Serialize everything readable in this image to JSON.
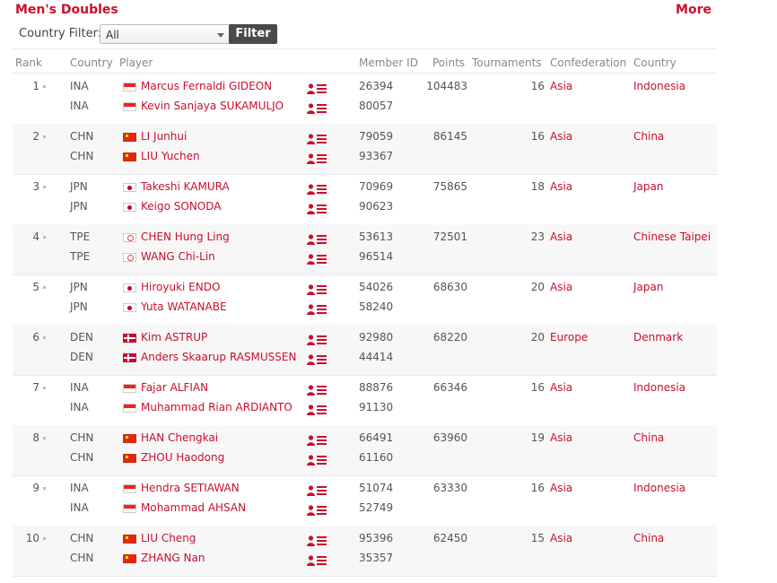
{
  "header": {
    "title": "Men's Doubles",
    "more": "More"
  },
  "filter": {
    "label": "Country Filter:",
    "selected": "All",
    "button": "Filter"
  },
  "columns": {
    "rank": "Rank",
    "country": "Country",
    "player": "Player",
    "member_id": "Member ID",
    "points": "Points",
    "tournaments": "Tournaments",
    "confederation": "Confederation",
    "country_name": "Country"
  },
  "colors": {
    "accent": "#c8102e",
    "button_bg": "#4a4a4a"
  },
  "icons": {
    "player_profile": "player-profile-icon",
    "rank_marker": "rank-dot-icon"
  },
  "rankings": [
    {
      "rank": "1",
      "points": "104483",
      "tournaments": "16",
      "confederation": "Asia",
      "country_name": "Indonesia",
      "players": [
        {
          "country": "INA",
          "flag": "flag-ina",
          "name": "Marcus Fernaldi GIDEON",
          "member_id": "26394"
        },
        {
          "country": "INA",
          "flag": "flag-ina",
          "name": "Kevin Sanjaya SUKAMULJO",
          "member_id": "80057"
        }
      ]
    },
    {
      "rank": "2",
      "points": "86145",
      "tournaments": "16",
      "confederation": "Asia",
      "country_name": "China",
      "players": [
        {
          "country": "CHN",
          "flag": "flag-chn",
          "name": "LI Junhui",
          "member_id": "79059"
        },
        {
          "country": "CHN",
          "flag": "flag-chn",
          "name": "LIU Yuchen",
          "member_id": "93367"
        }
      ]
    },
    {
      "rank": "3",
      "points": "75865",
      "tournaments": "18",
      "confederation": "Asia",
      "country_name": "Japan",
      "players": [
        {
          "country": "JPN",
          "flag": "flag-jpn",
          "name": "Takeshi KAMURA",
          "member_id": "70969"
        },
        {
          "country": "JPN",
          "flag": "flag-jpn",
          "name": "Keigo SONODA",
          "member_id": "90623"
        }
      ]
    },
    {
      "rank": "4",
      "points": "72501",
      "tournaments": "23",
      "confederation": "Asia",
      "country_name": "Chinese Taipei",
      "players": [
        {
          "country": "TPE",
          "flag": "flag-tpe",
          "name": "CHEN Hung Ling",
          "member_id": "53613"
        },
        {
          "country": "TPE",
          "flag": "flag-tpe",
          "name": "WANG Chi-Lin",
          "member_id": "96514"
        }
      ]
    },
    {
      "rank": "5",
      "points": "68630",
      "tournaments": "20",
      "confederation": "Asia",
      "country_name": "Japan",
      "players": [
        {
          "country": "JPN",
          "flag": "flag-jpn",
          "name": "Hiroyuki ENDO",
          "member_id": "54026"
        },
        {
          "country": "JPN",
          "flag": "flag-jpn",
          "name": "Yuta WATANABE",
          "member_id": "58240"
        }
      ]
    },
    {
      "rank": "6",
      "points": "68220",
      "tournaments": "20",
      "confederation": "Europe",
      "country_name": "Denmark",
      "players": [
        {
          "country": "DEN",
          "flag": "flag-den",
          "name": "Kim ASTRUP",
          "member_id": "92980"
        },
        {
          "country": "DEN",
          "flag": "flag-den",
          "name": "Anders Skaarup RASMUSSEN",
          "member_id": "44414"
        }
      ]
    },
    {
      "rank": "7",
      "points": "66346",
      "tournaments": "16",
      "confederation": "Asia",
      "country_name": "Indonesia",
      "players": [
        {
          "country": "INA",
          "flag": "flag-ina",
          "name": "Fajar ALFIAN",
          "member_id": "88876"
        },
        {
          "country": "INA",
          "flag": "flag-ina",
          "name": "Muhammad Rian ARDIANTO",
          "member_id": "91130"
        }
      ]
    },
    {
      "rank": "8",
      "points": "63960",
      "tournaments": "19",
      "confederation": "Asia",
      "country_name": "China",
      "players": [
        {
          "country": "CHN",
          "flag": "flag-chn",
          "name": "HAN Chengkai",
          "member_id": "66491"
        },
        {
          "country": "CHN",
          "flag": "flag-chn",
          "name": "ZHOU Haodong",
          "member_id": "61160"
        }
      ]
    },
    {
      "rank": "9",
      "points": "63330",
      "tournaments": "16",
      "confederation": "Asia",
      "country_name": "Indonesia",
      "players": [
        {
          "country": "INA",
          "flag": "flag-ina",
          "name": "Hendra SETIAWAN",
          "member_id": "51074"
        },
        {
          "country": "INA",
          "flag": "flag-ina",
          "name": "Mohammad AHSAN",
          "member_id": "52749"
        }
      ]
    },
    {
      "rank": "10",
      "points": "62450",
      "tournaments": "15",
      "confederation": "Asia",
      "country_name": "China",
      "players": [
        {
          "country": "CHN",
          "flag": "flag-chn",
          "name": "LIU Cheng",
          "member_id": "95396"
        },
        {
          "country": "CHN",
          "flag": "flag-chn",
          "name": "ZHANG Nan",
          "member_id": "35357"
        }
      ]
    }
  ]
}
